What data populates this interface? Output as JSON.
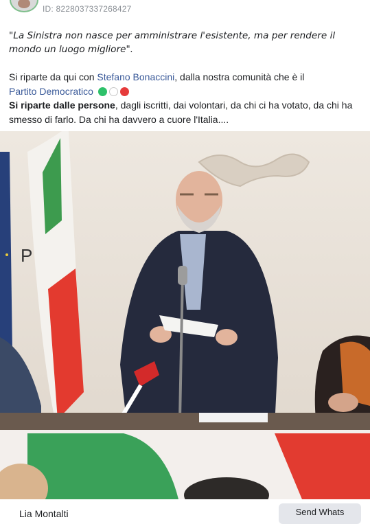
{
  "post": {
    "id_text": "ID: 8228037337268427",
    "quote": "\"La Sinistra non nasce per amministrare l'esistente, ma per rendere il mondo un luogo migliore\".",
    "p1_prefix": "Si riparte da qui con ",
    "p1_link1": "Stefano Bonaccini",
    "p1_middle": ", dalla nostra comunità che è il",
    "p1_link2": "Partito Democratico",
    "p2_bold": "Si riparte dalle persone",
    "p2_rest": ", dagli iscritti, dai volontari, da chi ci ha votato, da chi ha smesso di farlo. Da chi ha davvero a cuore l'Italia...."
  },
  "footer": {
    "name": "Lia Montalti",
    "send_button": "Send Whats"
  },
  "colors": {
    "link": "#385898",
    "dot_green": "#2ec16a",
    "dot_red": "#e63b3b",
    "text": "#1c1e21"
  }
}
